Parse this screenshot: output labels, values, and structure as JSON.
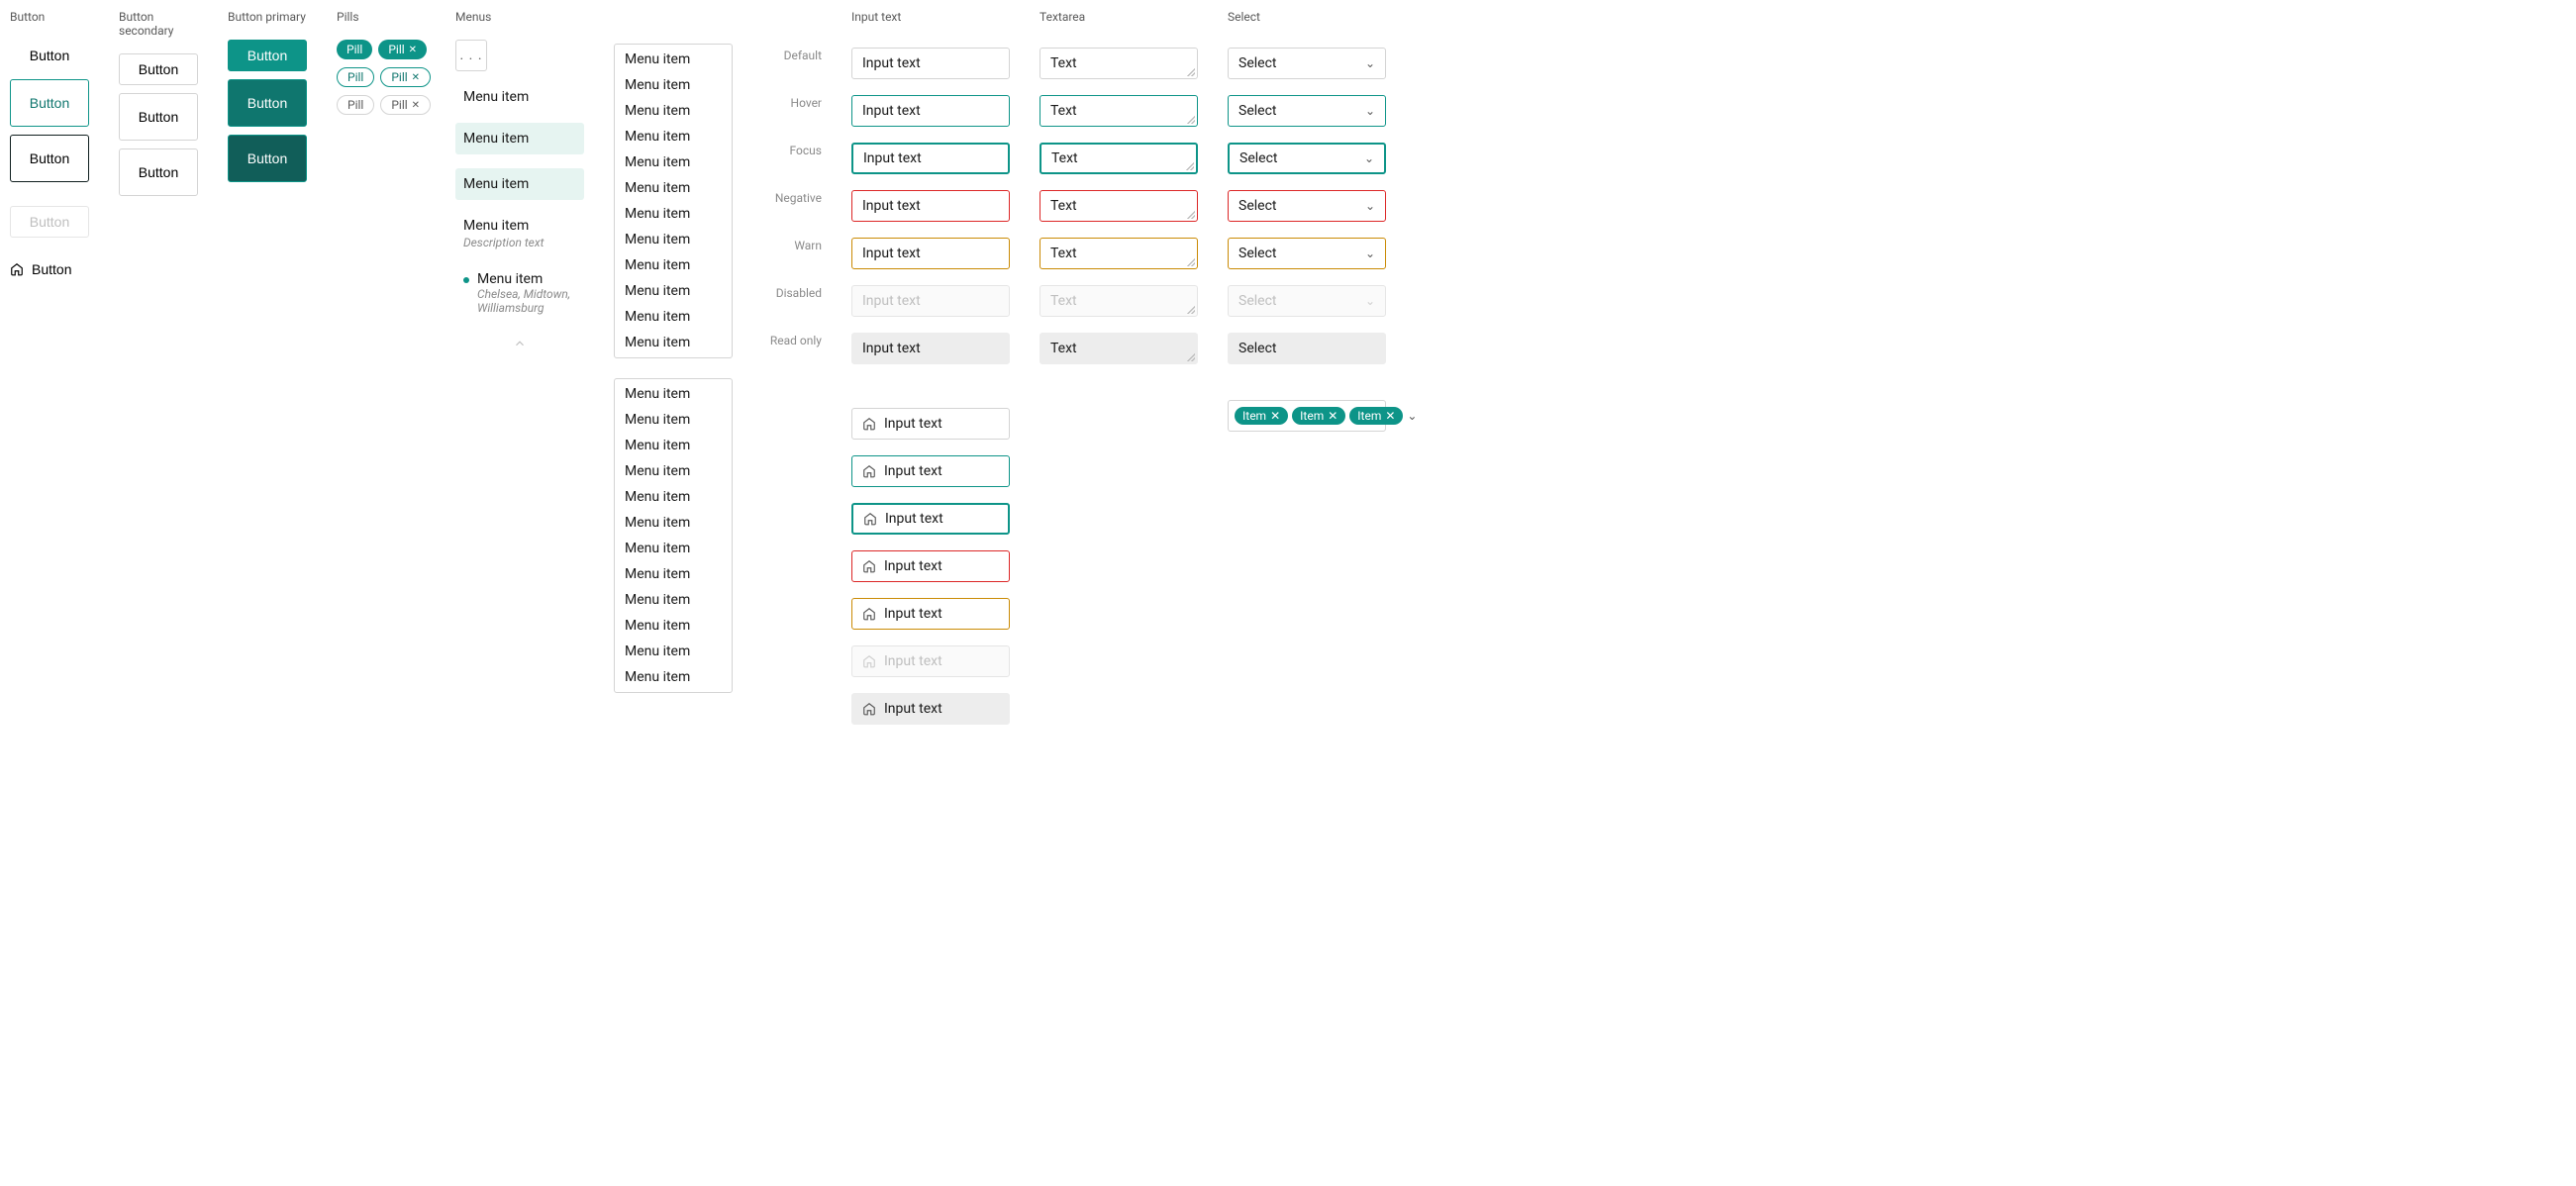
{
  "sections": {
    "button": "Button",
    "button_secondary": "Button secondary",
    "button_primary": "Button primary",
    "pills": "Pills",
    "menus": "Menus",
    "input_text": "Input text",
    "textarea": "Textarea",
    "select": "Select"
  },
  "button_label": "Button",
  "pill_label": "Pill",
  "menu_item": "Menu item",
  "menu_trigger": ". . .",
  "menu_description": "Description text",
  "menu_location_desc": "Chelsea, Midtown, Williamsburg",
  "menu_panel_a_count": 12,
  "menu_panel_b_count": 12,
  "states": {
    "default": "Default",
    "hover": "Hover",
    "focus": "Focus",
    "negative": "Negative",
    "warn": "Warn",
    "disabled": "Disabled",
    "readonly": "Read only"
  },
  "input_value": "Input text",
  "textarea_value": "Text",
  "select_value": "Select",
  "multiselect_item": "Item",
  "colors": {
    "teal": "#0d9488",
    "teal_dark": "#0f766e",
    "teal_darkest": "#115e59",
    "negative": "#dc2626",
    "warn": "#ca8a04"
  }
}
